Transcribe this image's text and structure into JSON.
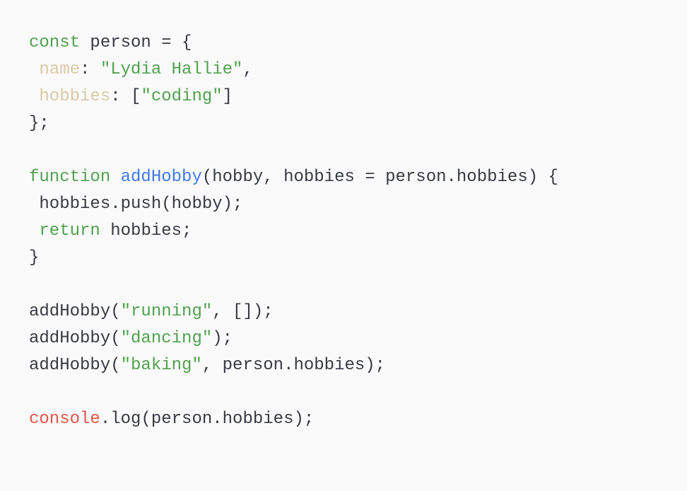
{
  "colors": {
    "background": "#fafafa",
    "text": "#383a42",
    "keyword": "#50a14f",
    "string": "#50a14f",
    "property": "#d9c9a5",
    "function": "#4078f2",
    "builtin": "#e45649"
  },
  "lines": [
    [
      {
        "t": "const",
        "c": "keyword"
      },
      {
        "t": " person = {",
        "c": "text"
      }
    ],
    [
      {
        "t": " ",
        "c": "text"
      },
      {
        "t": "name",
        "c": "property"
      },
      {
        "t": ": ",
        "c": "text"
      },
      {
        "t": "\"Lydia Hallie\"",
        "c": "string"
      },
      {
        "t": ",",
        "c": "text"
      }
    ],
    [
      {
        "t": " ",
        "c": "text"
      },
      {
        "t": "hobbies",
        "c": "property"
      },
      {
        "t": ": [",
        "c": "text"
      },
      {
        "t": "\"coding\"",
        "c": "string"
      },
      {
        "t": "]",
        "c": "text"
      }
    ],
    [
      {
        "t": "};",
        "c": "text"
      }
    ],
    [],
    [
      {
        "t": "function",
        "c": "keyword"
      },
      {
        "t": " ",
        "c": "text"
      },
      {
        "t": "addHobby",
        "c": "function"
      },
      {
        "t": "(hobby, hobbies = person.hobbies) {",
        "c": "text"
      }
    ],
    [
      {
        "t": " hobbies.push(hobby);",
        "c": "text"
      }
    ],
    [
      {
        "t": " ",
        "c": "text"
      },
      {
        "t": "return",
        "c": "keyword"
      },
      {
        "t": " hobbies;",
        "c": "text"
      }
    ],
    [
      {
        "t": "}",
        "c": "text"
      }
    ],
    [],
    [
      {
        "t": "addHobby(",
        "c": "text"
      },
      {
        "t": "\"running\"",
        "c": "string"
      },
      {
        "t": ", []);",
        "c": "text"
      }
    ],
    [
      {
        "t": "addHobby(",
        "c": "text"
      },
      {
        "t": "\"dancing\"",
        "c": "string"
      },
      {
        "t": ");",
        "c": "text"
      }
    ],
    [
      {
        "t": "addHobby(",
        "c": "text"
      },
      {
        "t": "\"baking\"",
        "c": "string"
      },
      {
        "t": ", person.hobbies);",
        "c": "text"
      }
    ],
    [],
    [
      {
        "t": "console",
        "c": "builtin"
      },
      {
        "t": ".log(person.hobbies);",
        "c": "text"
      }
    ]
  ]
}
